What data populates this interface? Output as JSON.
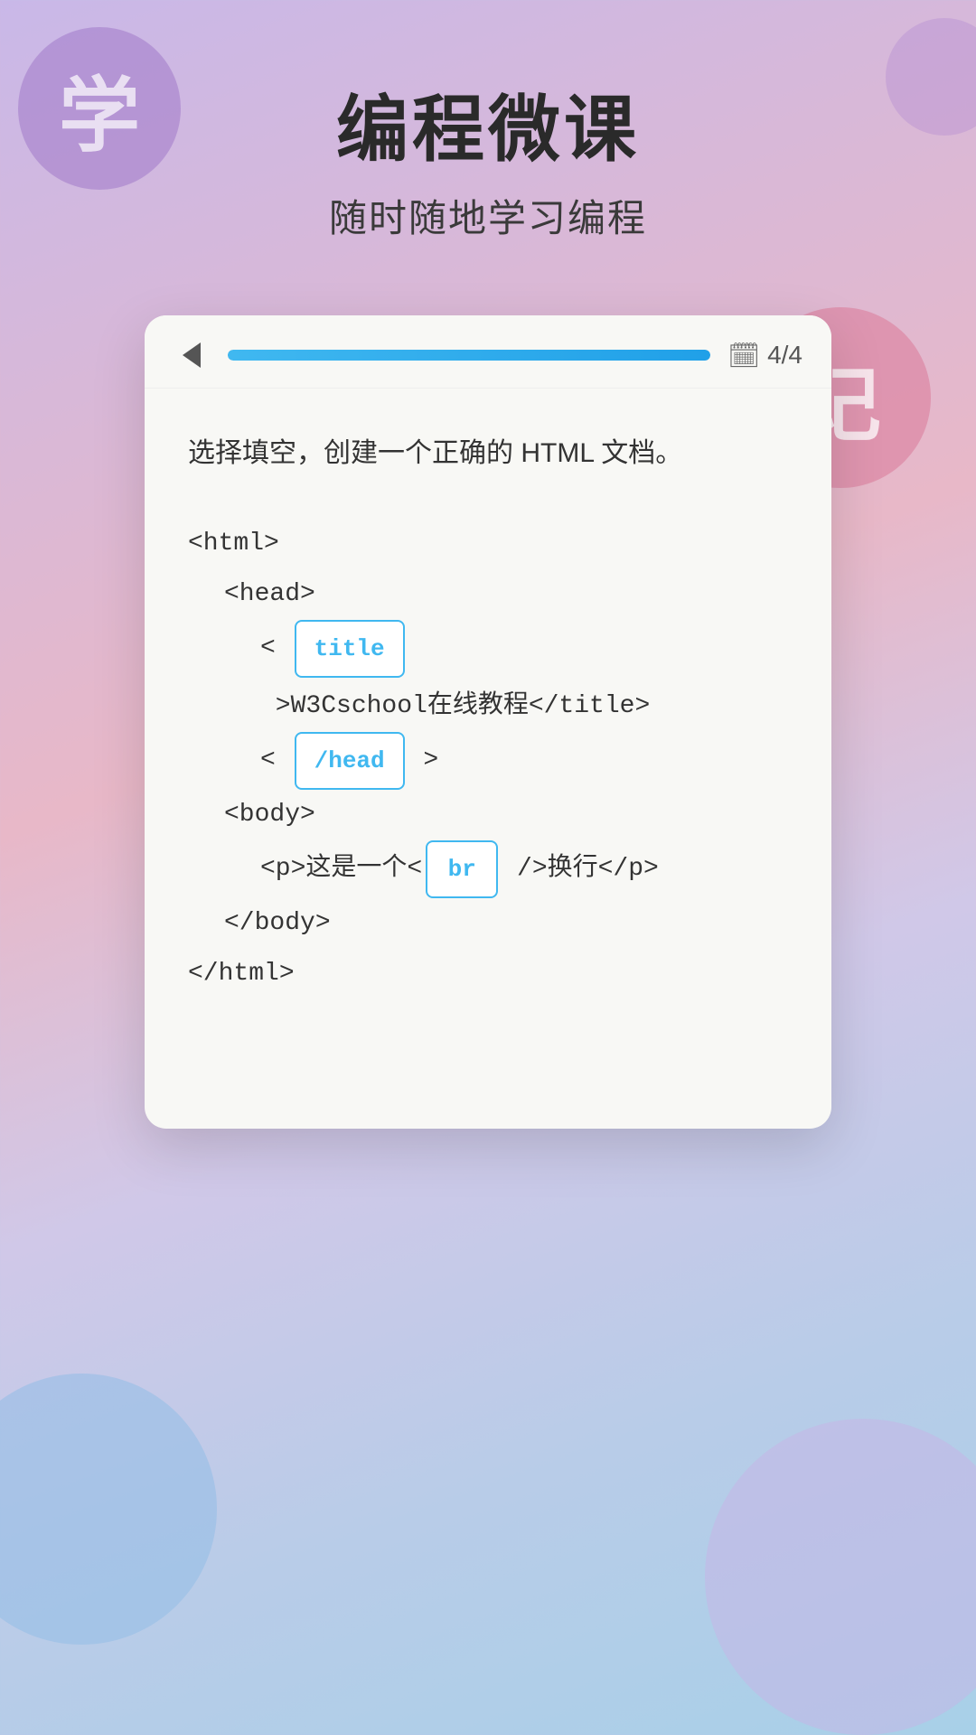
{
  "app": {
    "title": "编程微课",
    "subtitle": "随时随地学习编程",
    "circle_left_char": "学",
    "circle_right_char": "记"
  },
  "card": {
    "back_icon_label": "←",
    "progress_percent": 100,
    "page_current": 4,
    "page_total": 4,
    "page_label": "4/4"
  },
  "question": {
    "instruction": "选择填空，创建一个正确的 HTML 文档。"
  },
  "code_lines": [
    {
      "indent": 0,
      "type": "plain",
      "text": "<html>"
    },
    {
      "indent": 1,
      "type": "plain",
      "text": "<head>"
    },
    {
      "indent": 2,
      "type": "blank_line",
      "before": "< ",
      "blank": "title",
      "after": " >W3Cschool在线教程</title>"
    },
    {
      "indent": 2,
      "type": "blank_line",
      "before": "< ",
      "blank": "/head",
      "after": " >"
    },
    {
      "indent": 1,
      "type": "plain",
      "text": "<body>"
    },
    {
      "indent": 2,
      "type": "blank_line_mid",
      "before": "<p>这是一个<",
      "blank": "br",
      "after": " />换行</p>"
    },
    {
      "indent": 1,
      "type": "plain",
      "text": "</body>"
    },
    {
      "indent": 0,
      "type": "plain",
      "text": "</html>"
    }
  ],
  "chips": {
    "chip1": "title",
    "chip2": "/head",
    "chip3": "br"
  },
  "colors": {
    "accent": "#40b8f0",
    "progress_fill": "#40b8f0"
  }
}
